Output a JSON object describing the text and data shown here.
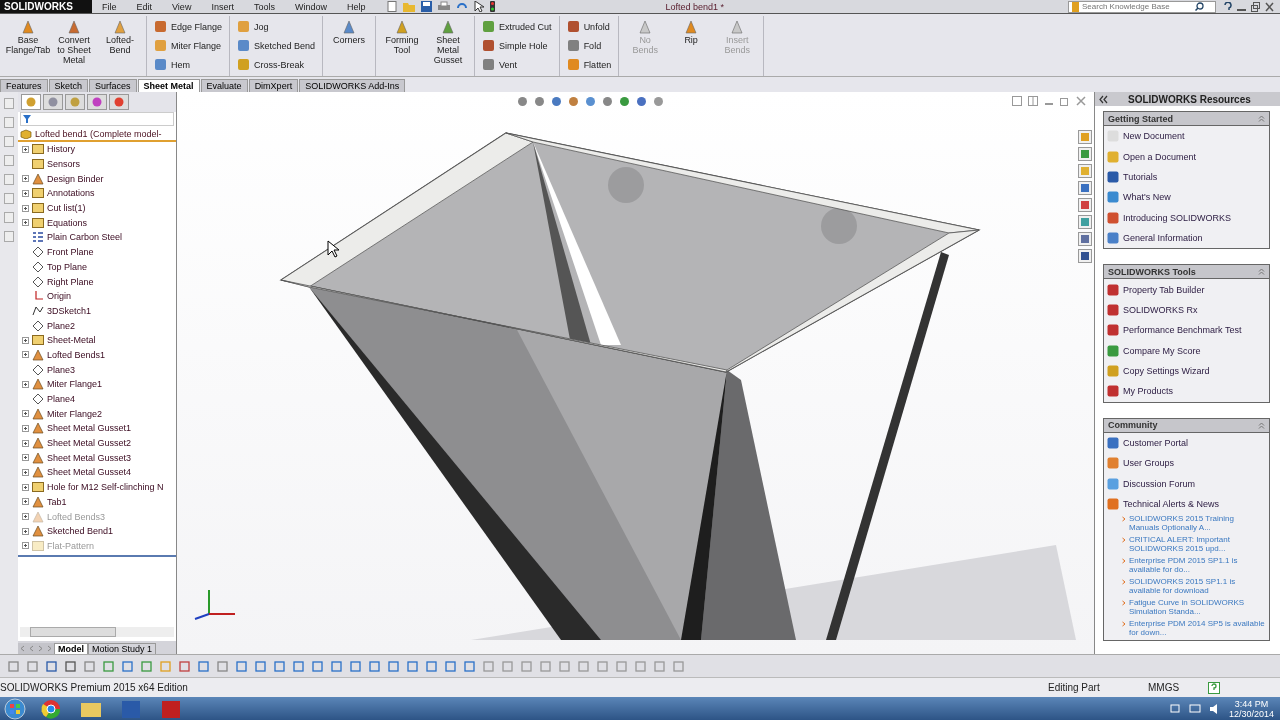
{
  "title_bar": {
    "logo": "SOLIDWORKS",
    "menu": [
      "File",
      "Edit",
      "View",
      "Insert",
      "Tools",
      "Window",
      "Help"
    ],
    "document_title": "Lofted bend1 *",
    "search": {
      "placeholder": "Search Knowledge Base"
    }
  },
  "command_manager": {
    "groups": [
      {
        "kind": "large",
        "tools": [
          {
            "label": "Base Flange/Tab",
            "disabled": false
          },
          {
            "label": "Convert to Sheet Metal",
            "disabled": false
          },
          {
            "label": "Lofted-Bend",
            "disabled": false
          }
        ]
      },
      {
        "kind": "column",
        "tools": [
          {
            "label": "Edge Flange",
            "disabled": false
          },
          {
            "label": "Miter Flange",
            "disabled": false
          },
          {
            "label": "Hem",
            "disabled": false
          }
        ]
      },
      {
        "kind": "column",
        "tools": [
          {
            "label": "Jog",
            "disabled": false
          },
          {
            "label": "Sketched Bend",
            "disabled": false
          },
          {
            "label": "Cross-Break",
            "disabled": false
          }
        ]
      },
      {
        "kind": "large",
        "tools": [
          {
            "label": "Corners",
            "disabled": false
          }
        ]
      },
      {
        "kind": "large",
        "tools": [
          {
            "label": "Forming Tool",
            "disabled": false
          },
          {
            "label": "Sheet Metal Gusset",
            "disabled": false
          }
        ]
      },
      {
        "kind": "column",
        "tools": [
          {
            "label": "Extruded Cut",
            "disabled": false
          },
          {
            "label": "Simple Hole",
            "disabled": false
          },
          {
            "label": "Vent",
            "disabled": false
          }
        ]
      },
      {
        "kind": "column",
        "tools": [
          {
            "label": "Unfold",
            "disabled": false
          },
          {
            "label": "Fold",
            "disabled": false
          },
          {
            "label": "Flatten",
            "disabled": false
          }
        ]
      },
      {
        "kind": "large",
        "tools": [
          {
            "label": "No Bends",
            "disabled": true
          },
          {
            "label": "Rip",
            "disabled": false
          },
          {
            "label": "Insert Bends",
            "disabled": true
          }
        ]
      }
    ]
  },
  "tabs": [
    {
      "label": "Features",
      "selected": false
    },
    {
      "label": "Sketch",
      "selected": false
    },
    {
      "label": "Surfaces",
      "selected": false
    },
    {
      "label": "Sheet Metal",
      "selected": true
    },
    {
      "label": "Evaluate",
      "selected": false
    },
    {
      "label": "DimXpert",
      "selected": false
    },
    {
      "label": "SOLIDWORKS Add-Ins",
      "selected": false
    }
  ],
  "panel_tabs": [
    {
      "selected": true
    },
    {
      "selected": false
    },
    {
      "selected": false
    },
    {
      "selected": false
    },
    {
      "selected": false
    }
  ],
  "feature_tree": {
    "root": "Lofted bend1  (Complete model-",
    "items": [
      {
        "label": "History",
        "kind": "folder",
        "expandable": true,
        "suppressed": false
      },
      {
        "label": "Sensors",
        "kind": "folder",
        "expandable": false,
        "suppressed": false
      },
      {
        "label": "Design Binder",
        "kind": "feature",
        "expandable": true,
        "suppressed": false
      },
      {
        "label": "Annotations",
        "kind": "folder",
        "expandable": true,
        "suppressed": false
      },
      {
        "label": "Cut list(1)",
        "kind": "folder",
        "expandable": true,
        "suppressed": false
      },
      {
        "label": "Equations",
        "kind": "folder",
        "expandable": true,
        "suppressed": false
      },
      {
        "label": "Plain Carbon Steel",
        "kind": "material",
        "expandable": false,
        "suppressed": false
      },
      {
        "label": "Front Plane",
        "kind": "plane",
        "expandable": false,
        "suppressed": false
      },
      {
        "label": "Top Plane",
        "kind": "plane",
        "expandable": false,
        "suppressed": false
      },
      {
        "label": "Right Plane",
        "kind": "plane",
        "expandable": false,
        "suppressed": false
      },
      {
        "label": "Origin",
        "kind": "origin",
        "expandable": false,
        "suppressed": false
      },
      {
        "label": "3DSketch1",
        "kind": "sketch",
        "expandable": false,
        "suppressed": false
      },
      {
        "label": "Plane2",
        "kind": "plane",
        "expandable": false,
        "suppressed": false
      },
      {
        "label": "Sheet-Metal",
        "kind": "folder",
        "expandable": true,
        "suppressed": false
      },
      {
        "label": "Lofted Bends1",
        "kind": "feature",
        "expandable": true,
        "suppressed": false
      },
      {
        "label": "Plane3",
        "kind": "plane",
        "expandable": false,
        "suppressed": false
      },
      {
        "label": "Miter Flange1",
        "kind": "feature",
        "expandable": true,
        "suppressed": false
      },
      {
        "label": "Plane4",
        "kind": "plane",
        "expandable": false,
        "suppressed": false
      },
      {
        "label": "Miter Flange2",
        "kind": "feature",
        "expandable": true,
        "suppressed": false
      },
      {
        "label": "Sheet Metal Gusset1",
        "kind": "feature",
        "expandable": true,
        "suppressed": false
      },
      {
        "label": "Sheet Metal Gusset2",
        "kind": "feature",
        "expandable": true,
        "suppressed": false
      },
      {
        "label": "Sheet Metal Gusset3",
        "kind": "feature",
        "expandable": true,
        "suppressed": false
      },
      {
        "label": "Sheet Metal Gusset4",
        "kind": "feature",
        "expandable": true,
        "suppressed": false
      },
      {
        "label": "Hole for M12 Self-clinching N",
        "kind": "folder",
        "expandable": true,
        "suppressed": false
      },
      {
        "label": "Tab1",
        "kind": "feature",
        "expandable": true,
        "suppressed": false
      },
      {
        "label": "Lofted Bends3",
        "kind": "feature",
        "expandable": true,
        "suppressed": true
      },
      {
        "label": "Sketched Bend1",
        "kind": "feature",
        "expandable": true,
        "suppressed": false
      },
      {
        "label": "Flat-Pattern",
        "kind": "folder",
        "expandable": true,
        "suppressed": true
      }
    ]
  },
  "bottom_tabs": [
    {
      "label": "Model",
      "selected": true
    },
    {
      "label": "Motion Study 1",
      "selected": false
    }
  ],
  "resources": {
    "title": "SOLIDWORKS Resources",
    "sections": [
      {
        "title": "Getting Started",
        "items": [
          "New Document",
          "Open a Document",
          "Tutorials",
          "What's New",
          "Introducing SOLIDWORKS",
          "General Information"
        ]
      },
      {
        "title": "SOLIDWORKS Tools",
        "items": [
          "Property Tab Builder",
          "SOLIDWORKS Rx",
          "Performance Benchmark Test",
          "Compare My Score",
          "Copy Settings Wizard",
          "My Products"
        ]
      },
      {
        "title": "Community",
        "items": [
          "Customer Portal",
          "User Groups",
          "Discussion Forum",
          "Technical Alerts & News"
        ],
        "news": [
          "SOLIDWORKS 2015 Training Manuals Optionally A...",
          "CRITICAL ALERT: Important SOLIDWORKS 2015 upd...",
          "Enterprise PDM 2015 SP1.1 is available for do...",
          "SOLIDWORKS 2015 SP1.1 is available for download",
          "Fatigue Curve in SOLIDWORKS Simulation Standa...",
          "Enterprise PDM 2014 SP5 is available for down..."
        ]
      }
    ]
  },
  "status_bar": {
    "edition": "SOLIDWORKS Premium 2015 x64 Edition",
    "mode": "Editing Part",
    "units": "MMGS"
  },
  "taskbar": {
    "time": "3:44 PM",
    "date": "12/30/2014"
  }
}
